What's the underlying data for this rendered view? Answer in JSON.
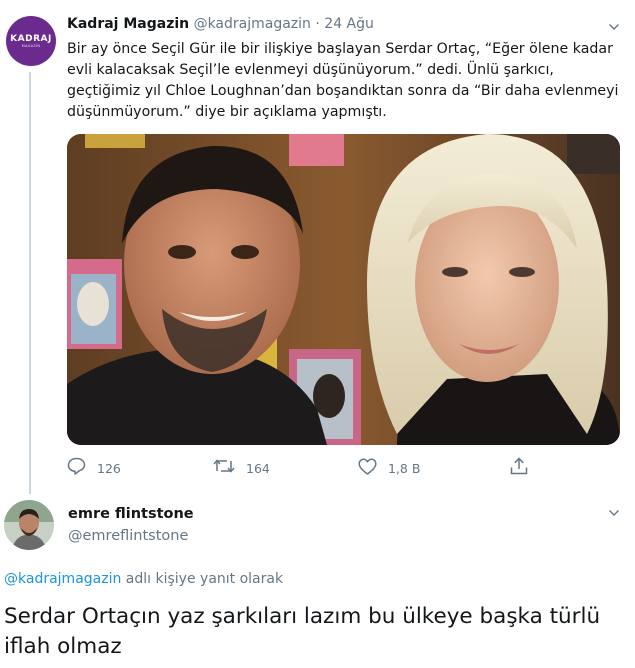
{
  "tweet1": {
    "avatar_text": "KADRAJ",
    "avatar_subtext": "MAGAZİN",
    "name": "Kadraj Magazin",
    "handle": "@kadrajmagazin",
    "separator": "·",
    "date": "24 Ağu",
    "text": "Bir ay önce Seçil Gür ile bir ilişkiye başlayan Serdar Ortaç, “Eğer ölene kadar\nevli kalacaksak Seçil’le evlenmeyi düşünüyorum.” dedi. Ünlü şarkıcı,\ngeçtiğimiz yıl Chloe Loughnan’dan boşandıktan sonra da “Bir daha evlenmeyi\ndüşünmüyorum.” diye bir açıklama yapmıştı.",
    "actions": {
      "reply_count": "126",
      "retweet_count": "164",
      "like_count": "1,8 B"
    }
  },
  "tweet2": {
    "name": "emre flintstone",
    "handle": "@emreflintstone",
    "reply_mention": "@kadrajmagazin",
    "reply_suffix": " adlı kişiye yanıt olarak",
    "text": "Serdar Ortaçın yaz şarkıları lazım bu ülkeye başka türlü iflah olmaz"
  },
  "colors": {
    "text": "#14171a",
    "secondary": "#657786",
    "link": "#1b95e0",
    "thread_line": "#ccd6dd",
    "avatar_brand": "#6a2a8e"
  },
  "icons": [
    "reply-icon",
    "retweet-icon",
    "like-icon",
    "share-icon",
    "chevron-down-icon"
  ]
}
